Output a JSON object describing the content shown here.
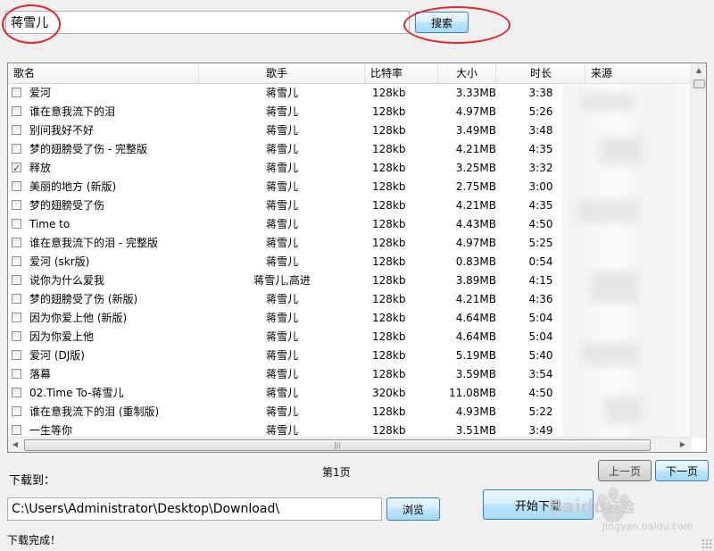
{
  "search": {
    "value": "蒋雪儿",
    "button_label": "搜索"
  },
  "columns": [
    "歌名",
    "歌手",
    "比特率",
    "大小",
    "时长",
    "来源"
  ],
  "rows": [
    {
      "title": "爱河",
      "artist": "蒋雪儿",
      "bitrate": "128kb",
      "size": "3.33MB",
      "duration": "3:38",
      "checked": false
    },
    {
      "title": "谁在意我流下的泪",
      "artist": "蒋雪儿",
      "bitrate": "128kb",
      "size": "4.97MB",
      "duration": "5:26",
      "checked": false
    },
    {
      "title": "别问我好不好",
      "artist": "蒋雪儿",
      "bitrate": "128kb",
      "size": "3.49MB",
      "duration": "3:48",
      "checked": false
    },
    {
      "title": "梦的翅膀受了伤 - 完整版",
      "artist": "蒋雪儿",
      "bitrate": "128kb",
      "size": "4.21MB",
      "duration": "4:35",
      "checked": false
    },
    {
      "title": "释放",
      "artist": "蒋雪儿",
      "bitrate": "128kb",
      "size": "3.25MB",
      "duration": "3:32",
      "checked": true
    },
    {
      "title": "美丽的地方 (新版)",
      "artist": "蒋雪儿",
      "bitrate": "128kb",
      "size": "2.75MB",
      "duration": "3:00",
      "checked": false
    },
    {
      "title": "梦的翅膀受了伤",
      "artist": "蒋雪儿",
      "bitrate": "128kb",
      "size": "4.21MB",
      "duration": "4:35",
      "checked": false
    },
    {
      "title": "Time to",
      "artist": "蒋雪儿",
      "bitrate": "128kb",
      "size": "4.43MB",
      "duration": "4:50",
      "checked": false
    },
    {
      "title": "谁在意我流下的泪 - 完整版",
      "artist": "蒋雪儿",
      "bitrate": "128kb",
      "size": "4.97MB",
      "duration": "5:25",
      "checked": false
    },
    {
      "title": "爱河 (skr版)",
      "artist": "蒋雪儿",
      "bitrate": "128kb",
      "size": "0.83MB",
      "duration": "0:54",
      "checked": false
    },
    {
      "title": "说你为什么爱我",
      "artist": "蒋雪儿,高进",
      "bitrate": "128kb",
      "size": "3.89MB",
      "duration": "4:15",
      "checked": false
    },
    {
      "title": "梦的翅膀受了伤 (新版)",
      "artist": "蒋雪儿",
      "bitrate": "128kb",
      "size": "4.21MB",
      "duration": "4:36",
      "checked": false
    },
    {
      "title": "因为你爱上他 (新版)",
      "artist": "蒋雪儿",
      "bitrate": "128kb",
      "size": "4.64MB",
      "duration": "5:04",
      "checked": false
    },
    {
      "title": "因为你爱上他",
      "artist": "蒋雪儿",
      "bitrate": "128kb",
      "size": "4.64MB",
      "duration": "5:04",
      "checked": false
    },
    {
      "title": "爱河 (DJ版)",
      "artist": "蒋雪儿",
      "bitrate": "128kb",
      "size": "5.19MB",
      "duration": "5:40",
      "checked": false
    },
    {
      "title": "落幕",
      "artist": "蒋雪儿",
      "bitrate": "128kb",
      "size": "3.59MB",
      "duration": "3:54",
      "checked": false
    },
    {
      "title": "02.Time To-蒋雪儿",
      "artist": "蒋雪儿",
      "bitrate": "320kb",
      "size": "11.08MB",
      "duration": "4:50",
      "checked": false
    },
    {
      "title": "谁在意我流下的泪 (重制版)",
      "artist": "蒋雪儿",
      "bitrate": "128kb",
      "size": "4.93MB",
      "duration": "5:22",
      "checked": false
    },
    {
      "title": "一生等你",
      "artist": "蒋雪儿",
      "bitrate": "128kb",
      "size": "3.51MB",
      "duration": "3:49",
      "checked": false
    }
  ],
  "pagination": {
    "page_label": "第1页",
    "prev_label": "上一页",
    "next_label": "下一页"
  },
  "download": {
    "label": "下载到：",
    "path": "C:\\Users\\Administrator\\Desktop\\Download\\",
    "browse_label": "浏览",
    "start_label": "开始下载"
  },
  "status": "下载完成！",
  "watermark": {
    "brand": "Baidu",
    "brand_suffix": "经验",
    "url": "jingyan.baidu.com"
  },
  "colors": {
    "annotation_red": "#e0262e",
    "button_blue": "#a7d9f5",
    "window_bg": "#f0f0f0"
  }
}
